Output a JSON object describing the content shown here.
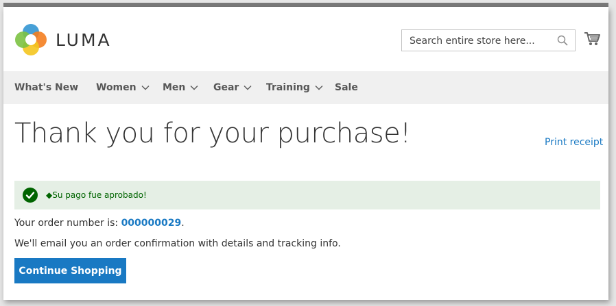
{
  "header": {
    "brand": "LUMA",
    "search_placeholder": "Search entire store here...",
    "icons": [
      "luma-logo-icon",
      "search-icon",
      "cart-icon"
    ]
  },
  "nav": {
    "items": [
      {
        "label": "What's New",
        "has_dropdown": false
      },
      {
        "label": "Women",
        "has_dropdown": true
      },
      {
        "label": "Men",
        "has_dropdown": true
      },
      {
        "label": "Gear",
        "has_dropdown": true
      },
      {
        "label": "Training",
        "has_dropdown": true
      },
      {
        "label": "Sale",
        "has_dropdown": false
      }
    ]
  },
  "main": {
    "title": "Thank you for your purchase!",
    "print_link": "Print receipt",
    "message": "◆Su pago fue aprobado!",
    "order_prefix": "Your order number is: ",
    "order_number": "000000029",
    "order_suffix": ".",
    "email_text": "We'll email you an order confirmation with details and tracking info.",
    "continue_button": "Continue Shopping"
  },
  "colors": {
    "link": "#1979c3",
    "success_bg": "#e5efe5",
    "success_text": "#006400",
    "nav_bg": "#f0f0f0"
  }
}
